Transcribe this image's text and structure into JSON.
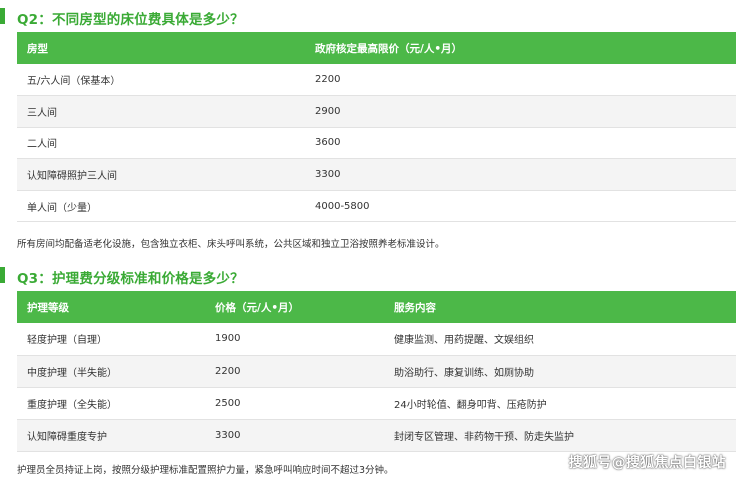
{
  "q2": {
    "title": "Q2：不同房型的床位费具体是多少？",
    "headers": [
      "房型",
      "政府核定最高限价（元/人•月）"
    ],
    "rows": [
      [
        "五/六人间（保基本）",
        "2200"
      ],
      [
        "三人间",
        "2900"
      ],
      [
        "二人间",
        "3600"
      ],
      [
        "认知障碍照护三人间",
        "3300"
      ],
      [
        "单人间（少量）",
        "4000-5800"
      ]
    ],
    "note": "所有房间均配备适老化设施，包含独立衣柜、床头呼叫系统，公共区域和独立卫浴按照养老标准设计。"
  },
  "q3": {
    "title": "Q3：护理费分级标准和价格是多少？",
    "headers": [
      "护理等级",
      "价格（元/人•月）",
      "服务内容"
    ],
    "rows": [
      [
        "轻度护理（自理）",
        "1900",
        "健康监测、用药提醒、文娱组织"
      ],
      [
        "中度护理（半失能）",
        "2200",
        "助浴助行、康复训练、如厕协助"
      ],
      [
        "重度护理（全失能）",
        "2500",
        "24小时轮值、翻身叩背、压疮防护"
      ],
      [
        "认知障碍重度专护",
        "3300",
        "封闭专区管理、非药物干预、防走失监护"
      ]
    ],
    "note": "护理员全员持证上岗，按照分级护理标准配置照护力量，紧急呼叫响应时间不超过3分钟。"
  },
  "watermark": "搜狐号@搜狐焦点白银站",
  "colors": {
    "accent": "#3aaa35",
    "header_bg": "#4cb848",
    "row_alt": "#f4f4f4"
  }
}
